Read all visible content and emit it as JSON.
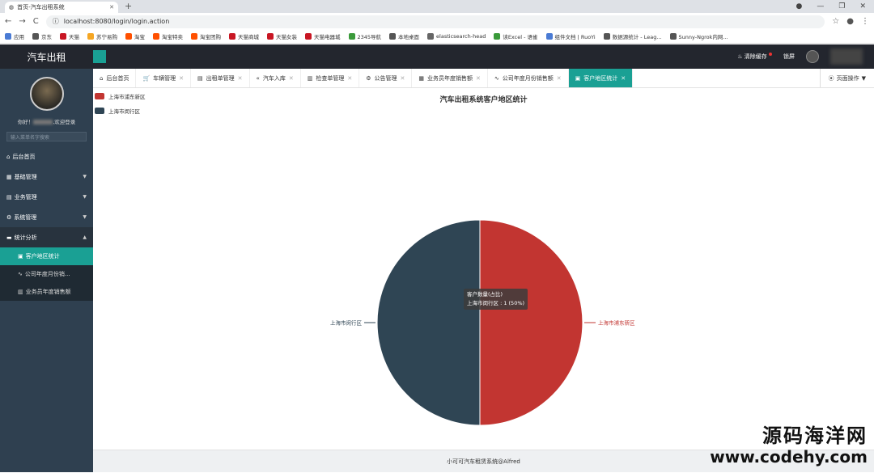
{
  "browser": {
    "tab_title": "首页-汽车出租系统",
    "new_tab": "+",
    "url": "localhost:8080/login/login.action",
    "window_controls": [
      "—",
      "❐",
      "✕"
    ],
    "bookmarks": [
      {
        "label": "应用",
        "color": "#4a7bd4"
      },
      {
        "label": "京东",
        "color": "#555"
      },
      {
        "label": "天猫",
        "color": "#c81623"
      },
      {
        "label": "苏宁易购",
        "color": "#f5a623"
      },
      {
        "label": "淘宝",
        "color": "#ff5000"
      },
      {
        "label": "淘宝特卖",
        "color": "#ff5000"
      },
      {
        "label": "淘宝团购",
        "color": "#ff5000"
      },
      {
        "label": "天猫商城",
        "color": "#c81623"
      },
      {
        "label": "天猫女装",
        "color": "#c81623"
      },
      {
        "label": "天猫电器城",
        "color": "#c81623"
      },
      {
        "label": "2345导航",
        "color": "#3a9a3a"
      },
      {
        "label": "本地桌面",
        "color": "#555"
      },
      {
        "label": "elasticsearch-head",
        "color": "#666"
      },
      {
        "label": "读Excel - 语雀",
        "color": "#3a9a3a"
      },
      {
        "label": "组件文档 | RuoYi",
        "color": "#4a7bd4"
      },
      {
        "label": "数据源统计 - Leag...",
        "color": "#555"
      },
      {
        "label": "Sunny-Ngrok内网...",
        "color": "#555"
      }
    ]
  },
  "header": {
    "logo": "汽车出租",
    "clear_cache": "清除缓存",
    "lock_screen": "锁屏"
  },
  "sidebar": {
    "welcome_prefix": "你好！",
    "welcome_suffix": ",欢迎登录",
    "search_placeholder": "输入菜单名字搜索",
    "items": [
      {
        "label": "后台首页",
        "icon": "home-icon",
        "arrow": ""
      },
      {
        "label": "基础管理",
        "icon": "grid-icon",
        "arrow": "▼"
      },
      {
        "label": "业务管理",
        "icon": "list-icon",
        "arrow": "▼"
      },
      {
        "label": "系统管理",
        "icon": "gear-icon",
        "arrow": "▼"
      },
      {
        "label": "统计分析",
        "icon": "monitor-icon",
        "arrow": "▲"
      }
    ],
    "sub_items": [
      {
        "label": "客户地区统计",
        "icon": "doc-icon"
      },
      {
        "label": "公司年度月份销...",
        "icon": "chart-line-icon"
      },
      {
        "label": "业务员年度销售额",
        "icon": "bar-icon"
      }
    ]
  },
  "tabs": [
    {
      "label": "后台首页",
      "icon": "⌂",
      "closable": false
    },
    {
      "label": "车辆管理",
      "icon": "🛒",
      "closable": true
    },
    {
      "label": "出租单管理",
      "icon": "▤",
      "closable": true
    },
    {
      "label": "汽车入库",
      "icon": "«",
      "closable": true
    },
    {
      "label": "检查单管理",
      "icon": "▥",
      "closable": true
    },
    {
      "label": "公告管理",
      "icon": "⚙",
      "closable": true
    },
    {
      "label": "业务员年度销售额",
      "icon": "▦",
      "closable": true
    },
    {
      "label": "公司年度月份销售额",
      "icon": "∿",
      "closable": true
    },
    {
      "label": "客户地区统计",
      "icon": "▣",
      "closable": true
    }
  ],
  "page_ops": "页面操作",
  "chart_data": {
    "type": "pie",
    "title": "汽车出租系统客户地区统计",
    "series_name": "客户数量(占比)",
    "slices": [
      {
        "name": "上海市浦东新区",
        "value": 1,
        "percent": 50,
        "color": "#c23531"
      },
      {
        "name": "上海市闵行区",
        "value": 1,
        "percent": 50,
        "color": "#2f4554"
      }
    ],
    "legend": "top-left",
    "tooltip": {
      "title": "客户数量(占比)",
      "line": "上海市闵行区 : 1 (50%)"
    }
  },
  "footer": "小可可汽车租赁系统@Alfred",
  "watermark": {
    "line1": "源码海洋网",
    "line2": "www.codehy.com"
  }
}
